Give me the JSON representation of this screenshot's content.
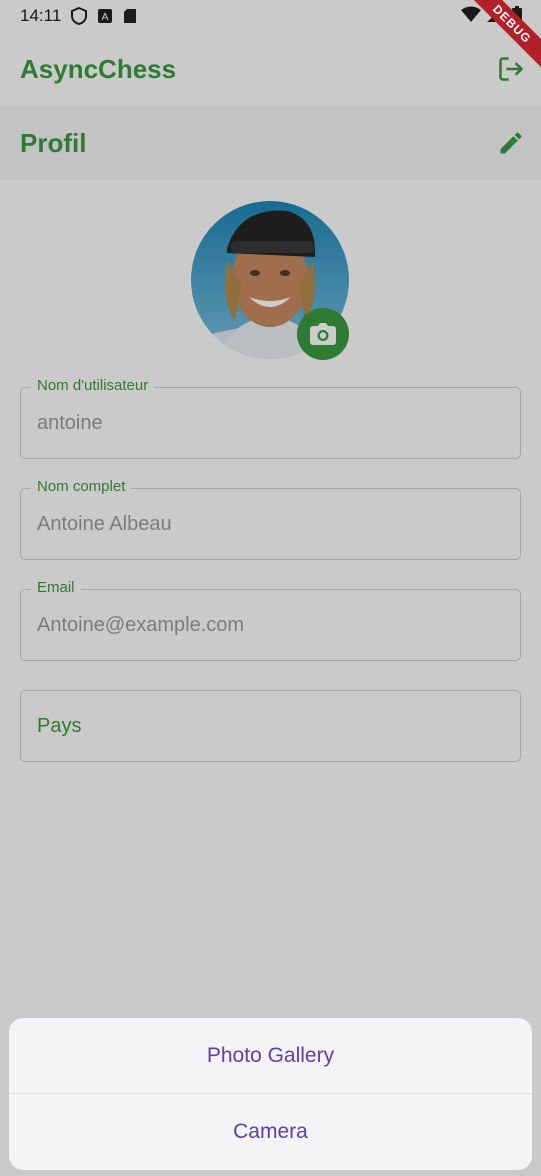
{
  "status_bar": {
    "time": "14:11"
  },
  "debug_banner": "DEBUG",
  "app_bar": {
    "title": "AsyncChess"
  },
  "profile": {
    "header": "Profil",
    "fields": [
      {
        "label": "Nom d'utilisateur",
        "value": "antoine"
      },
      {
        "label": "Nom complet",
        "value": "Antoine Albeau"
      },
      {
        "label": "Email",
        "value": "Antoine@example.com"
      },
      {
        "label": "",
        "value": "Pays"
      }
    ]
  },
  "sheet": {
    "options": [
      "Photo Gallery",
      "Camera"
    ]
  },
  "colors": {
    "accent": "#3d9a40",
    "sheet_text": "#5a42a8"
  }
}
